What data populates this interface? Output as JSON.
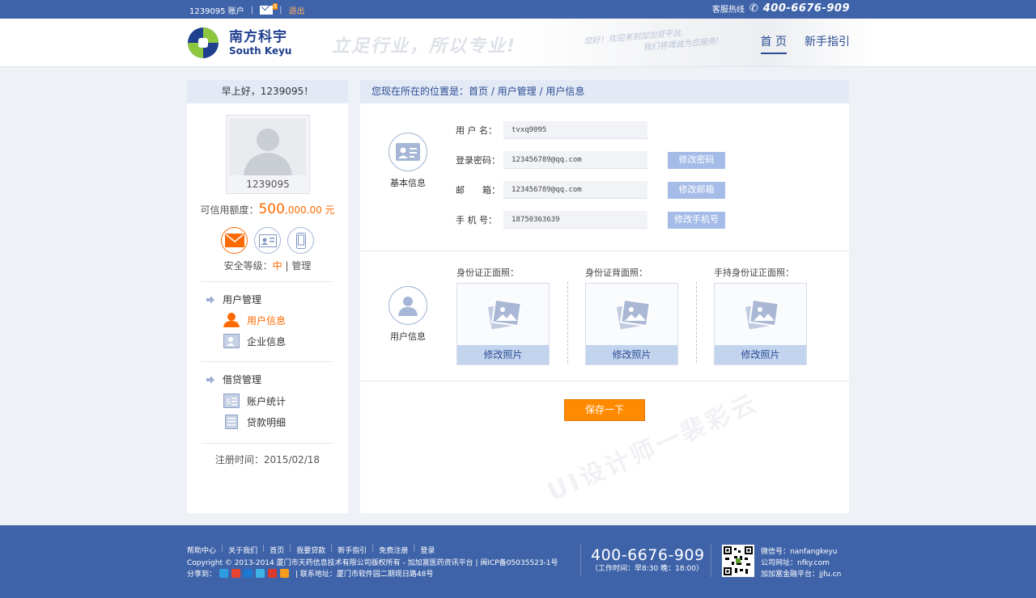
{
  "topbar": {
    "account": "1239095 账户",
    "sep": "|",
    "mail_count": "9",
    "logout": "退出",
    "hotline_label": "客服热线",
    "hotline": "400-6676-909"
  },
  "header": {
    "logo_cn": "南方科宇",
    "logo_en": "South Keyu",
    "slogan": "立足行业，所以专业!",
    "welcome_line1": "您好！欢迎来到加加贷平台,",
    "welcome_line2": "我们将竭诚为您服务!",
    "nav": [
      {
        "label": "首 页"
      },
      {
        "label": "新手指引"
      }
    ]
  },
  "sidebar": {
    "greeting": "早上好，1239095！",
    "username": "1239095",
    "credit_label": "可信用额度：",
    "credit_big": "500",
    "credit_small": ",000.00 元",
    "security_label": "安全等级：",
    "security_level": "中",
    "security_sep": "|",
    "security_manage": "管理",
    "groups": [
      {
        "label": "用户管理",
        "items": [
          {
            "label": "用户信息"
          },
          {
            "label": "企业信息"
          }
        ]
      },
      {
        "label": "借贷管理",
        "items": [
          {
            "label": "账户统计"
          },
          {
            "label": "贷款明细"
          }
        ]
      }
    ],
    "reg_time": "注册时间：2015/02/18"
  },
  "main": {
    "breadcrumb": "您现在所在的位置是：首页 / 用户管理 / 用户信息",
    "basic_label": "基本信息",
    "user_label": "用户信息",
    "fields": [
      {
        "label": "用 户 名：",
        "value": "tvxq9095",
        "button": ""
      },
      {
        "label": "登录密码：",
        "value": "123456789@qq.com",
        "button": "修改密码"
      },
      {
        "label": "邮　　箱：",
        "value": "123456789@qq.com",
        "button": "修改邮箱"
      },
      {
        "label": "手 机 号：",
        "value": "18750363639",
        "button": "修改手机号"
      }
    ],
    "photos": [
      {
        "title": "身份证正面照：",
        "button": "修改照片"
      },
      {
        "title": "身份证背面照：",
        "button": "修改照片"
      },
      {
        "title": "手持身份证正面照：",
        "button": "修改照片"
      }
    ],
    "save": "保存一下",
    "watermark": "UI设计师一裴彩云"
  },
  "footer": {
    "links": [
      "帮助中心",
      "关于我们",
      "首页",
      "我要贷款",
      "新手指引",
      "免费注册",
      "登录"
    ],
    "link_sep": "|",
    "copyright": "Copyright © 2013-2014  厦门市天药信息技术有限公司版权所有 - 加加富医药资讯平台  |  闽ICP备05035523-1号",
    "share_label": "分享到：",
    "address": "|  联系地址：厦门市软件园二期观日路48号",
    "phone": "400-6676-909",
    "hours": "（工作时间：早8:30 晚：18:00）",
    "wechat": "微信号：nanfangkeyu",
    "website": "公司网址：nfky.com",
    "finance": "加加富金融平台：jjfu.cn"
  },
  "colors": {
    "brand_blue": "#3f63a9",
    "accent_orange": "#ff8a00",
    "panel_header": "#e3eaf6",
    "button_blue": "#a5bce8"
  }
}
